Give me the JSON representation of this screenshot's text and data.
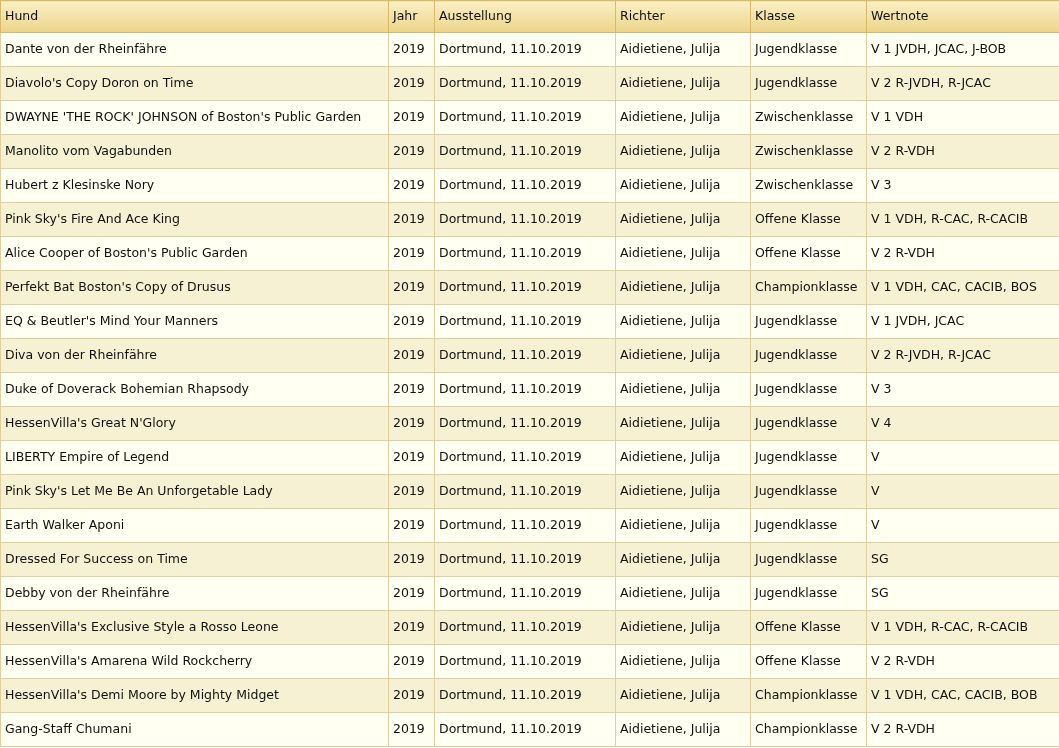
{
  "table": {
    "columns": [
      "Hund",
      "Jahr",
      "Ausstellung",
      "Richter",
      "Klasse",
      "Wertnote"
    ],
    "rows": [
      [
        "Dante von der Rheinfähre",
        "2019",
        "Dortmund, 11.10.2019",
        "Aidietiene, Julija",
        "Jugendklasse",
        "V 1 JVDH, JCAC, J-BOB"
      ],
      [
        "Diavolo's Copy Doron on Time",
        "2019",
        "Dortmund, 11.10.2019",
        "Aidietiene, Julija",
        "Jugendklasse",
        "V 2 R-JVDH, R-JCAC"
      ],
      [
        "DWAYNE 'THE ROCK' JOHNSON of Boston's Public Garden",
        "2019",
        "Dortmund, 11.10.2019",
        "Aidietiene, Julija",
        "Zwischenklasse",
        "V 1 VDH"
      ],
      [
        "Manolito vom Vagabunden",
        "2019",
        "Dortmund, 11.10.2019",
        "Aidietiene, Julija",
        "Zwischenklasse",
        "V 2 R-VDH"
      ],
      [
        "Hubert z Klesinske Nory",
        "2019",
        "Dortmund, 11.10.2019",
        "Aidietiene, Julija",
        "Zwischenklasse",
        "V 3"
      ],
      [
        "Pink Sky's Fire And Ace King",
        "2019",
        "Dortmund, 11.10.2019",
        "Aidietiene, Julija",
        "Offene Klasse",
        "V 1 VDH, R-CAC, R-CACIB"
      ],
      [
        "Alice Cooper of Boston's Public Garden",
        "2019",
        "Dortmund, 11.10.2019",
        "Aidietiene, Julija",
        "Offene Klasse",
        "V 2 R-VDH"
      ],
      [
        "Perfekt Bat Boston's Copy of Drusus",
        "2019",
        "Dortmund, 11.10.2019",
        "Aidietiene, Julija",
        "Championklasse",
        "V 1 VDH, CAC, CACIB, BOS"
      ],
      [
        "EQ & Beutler's Mind Your Manners",
        "2019",
        "Dortmund, 11.10.2019",
        "Aidietiene, Julija",
        "Jugendklasse",
        "V 1 JVDH, JCAC"
      ],
      [
        "Diva von der Rheinfähre",
        "2019",
        "Dortmund, 11.10.2019",
        "Aidietiene, Julija",
        "Jugendklasse",
        "V 2 R-JVDH, R-JCAC"
      ],
      [
        "Duke of Doverack Bohemian Rhapsody",
        "2019",
        "Dortmund, 11.10.2019",
        "Aidietiene, Julija",
        "Jugendklasse",
        "V 3"
      ],
      [
        "HessenVilla's Great N'Glory",
        "2019",
        "Dortmund, 11.10.2019",
        "Aidietiene, Julija",
        "Jugendklasse",
        "V 4"
      ],
      [
        "LIBERTY Empire of Legend",
        "2019",
        "Dortmund, 11.10.2019",
        "Aidietiene, Julija",
        "Jugendklasse",
        "V"
      ],
      [
        "Pink Sky's Let Me Be An Unforgetable Lady",
        "2019",
        "Dortmund, 11.10.2019",
        "Aidietiene, Julija",
        "Jugendklasse",
        "V"
      ],
      [
        "Earth Walker Aponi",
        "2019",
        "Dortmund, 11.10.2019",
        "Aidietiene, Julija",
        "Jugendklasse",
        "V"
      ],
      [
        "Dressed For Success on Time",
        "2019",
        "Dortmund, 11.10.2019",
        "Aidietiene, Julija",
        "Jugendklasse",
        "SG"
      ],
      [
        "Debby von der Rheinfähre",
        "2019",
        "Dortmund, 11.10.2019",
        "Aidietiene, Julija",
        "Jugendklasse",
        "SG"
      ],
      [
        "HessenVilla's Exclusive Style a Rosso Leone",
        "2019",
        "Dortmund, 11.10.2019",
        "Aidietiene, Julija",
        "Offene Klasse",
        "V 1 VDH, R-CAC, R-CACIB"
      ],
      [
        "HessenVilla's Amarena Wild Rockcherry",
        "2019",
        "Dortmund, 11.10.2019",
        "Aidietiene, Julija",
        "Offene Klasse",
        "V 2 R-VDH"
      ],
      [
        "HessenVilla's Demi Moore by Mighty Midget",
        "2019",
        "Dortmund, 11.10.2019",
        "Aidietiene, Julija",
        "Championklasse",
        "V 1 VDH, CAC, CACIB, BOB"
      ],
      [
        "Gang-Staff Chumani",
        "2019",
        "Dortmund, 11.10.2019",
        "Aidietiene, Julija",
        "Championklasse",
        "V 2 R-VDH"
      ]
    ]
  }
}
